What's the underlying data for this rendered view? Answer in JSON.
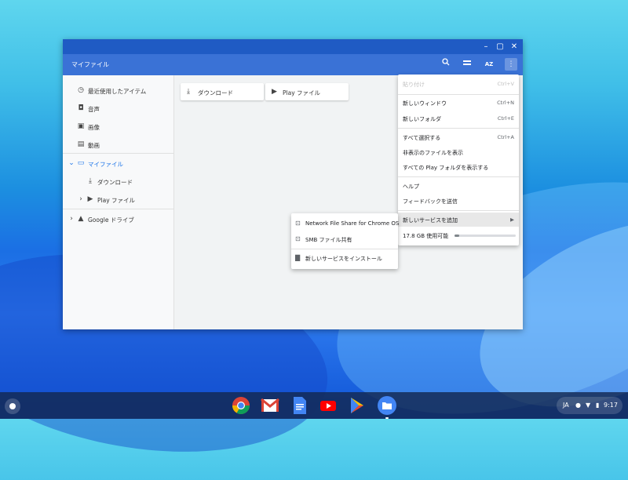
{
  "window": {
    "title": "マイファイル",
    "controls": [
      "minimize-icon",
      "maximize-icon",
      "close-icon"
    ]
  },
  "toolbar": {
    "buttons": [
      "search-icon",
      "view-icon",
      "sort-icon",
      "more-icon"
    ],
    "sort_label": "AZ"
  },
  "sidebar": {
    "items": [
      {
        "label": "最近使用したアイテム",
        "icon": "clock-icon"
      },
      {
        "label": "音声",
        "icon": "audio-icon"
      },
      {
        "label": "画像",
        "icon": "image-icon"
      },
      {
        "label": "動画",
        "icon": "video-icon"
      },
      {
        "label": "マイファイル",
        "icon": "computer-icon",
        "selected": true
      },
      {
        "label": "ダウンロード",
        "icon": "download-icon"
      },
      {
        "label": "Play ファイル",
        "icon": "play-icon"
      },
      {
        "label": "Google ドライブ",
        "icon": "drive-icon"
      }
    ]
  },
  "main": {
    "tiles": [
      {
        "label": "ダウンロード",
        "icon": "download-icon"
      },
      {
        "label": "Play ファイル",
        "icon": "play-icon"
      }
    ]
  },
  "menu": {
    "items": [
      {
        "label": "貼り付け",
        "shortcut": "Ctrl+V",
        "disabled": true
      },
      {
        "label": "新しいウィンドウ",
        "shortcut": "Ctrl+N"
      },
      {
        "label": "新しいフォルダ",
        "shortcut": "Ctrl+E"
      },
      {
        "label": "すべて選択する",
        "shortcut": "Ctrl+A"
      },
      {
        "label": "非表示のファイルを表示",
        "shortcut": ""
      },
      {
        "label": "すべての Play フォルダを表示する",
        "shortcut": ""
      },
      {
        "label": "ヘルプ",
        "shortcut": ""
      },
      {
        "label": "フィードバックを送信",
        "shortcut": ""
      },
      {
        "label": "新しいサービスを追加",
        "shortcut": "▶"
      },
      {
        "label": "17.8 GB 使用可能",
        "shortcut": ""
      }
    ],
    "storage_used_fraction": 0.08
  },
  "submenu": {
    "items": [
      {
        "label": "Network File Share for Chrome OS",
        "icon": "share-icon"
      },
      {
        "label": "SMB ファイル共有",
        "icon": "share-icon"
      },
      {
        "label": "新しいサービスをインストール",
        "icon": "shopping-bag-icon"
      }
    ]
  },
  "shelf": {
    "apps": [
      "chrome-icon",
      "gmail-icon",
      "docs-icon",
      "youtube-icon",
      "play-store-icon",
      "files-icon"
    ],
    "tray": {
      "ime": "JA",
      "time": "9:17"
    }
  },
  "colors": {
    "accent": "#1a73e8",
    "titlebar": "#1f5bc4",
    "toolbar": "#3a72d6"
  }
}
